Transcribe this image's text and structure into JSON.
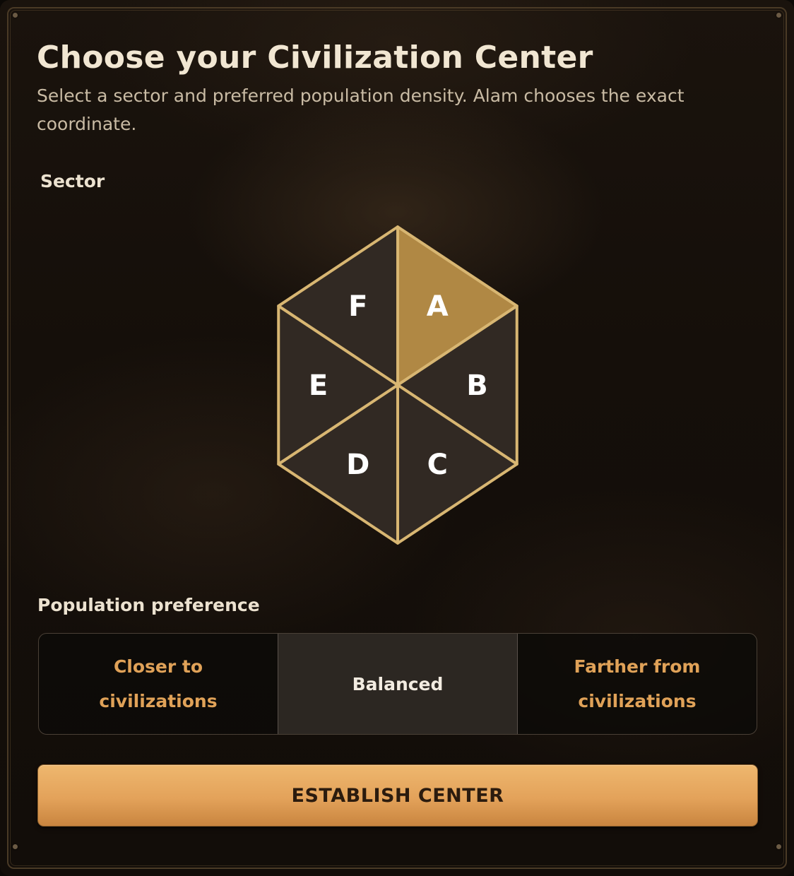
{
  "dialog": {
    "title": "Choose your Civilization Center",
    "subtitle": "Select a sector and preferred population density. Alam chooses the exact coordinate."
  },
  "sector_picker": {
    "label": "Sector",
    "selected": "A",
    "sectors": [
      "A",
      "B",
      "C",
      "D",
      "E",
      "F"
    ]
  },
  "population": {
    "label": "Population preference",
    "options": [
      "Closer to civilizations",
      "Balanced",
      "Farther from civilizations"
    ],
    "selected": "Balanced"
  },
  "action": {
    "establish_label": "ESTABLISH CENTER"
  },
  "colors": {
    "selected_sector": "#b08844",
    "sector_fill": "#312923",
    "sector_outline": "#d8b672",
    "option_text": "#e0a258",
    "button": "#e3a25a"
  }
}
